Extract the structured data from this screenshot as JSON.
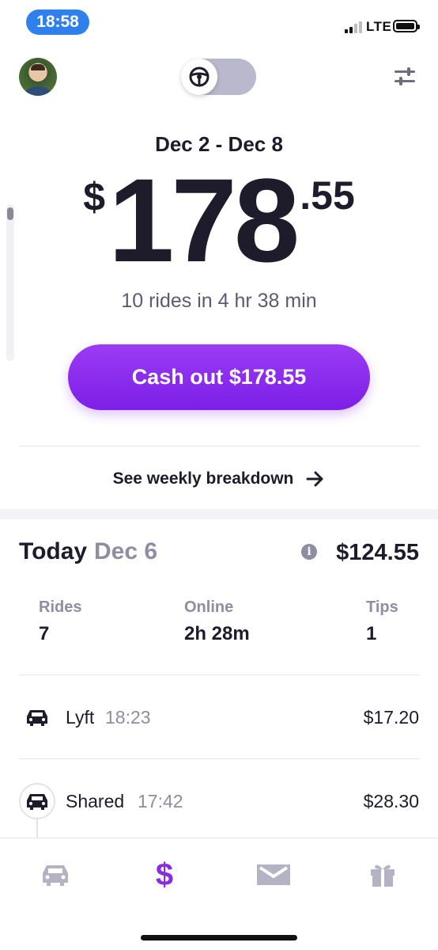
{
  "status_bar": {
    "time": "18:58",
    "network": "LTE"
  },
  "header": {
    "avatar": "profile-photo",
    "mode_toggle_icon": "steering-wheel-icon",
    "filter_icon": "sliders-icon"
  },
  "earnings": {
    "date_range": "Dec 2 - Dec 8",
    "currency_symbol": "$",
    "amount_whole": "178",
    "amount_cents": ".55",
    "rides_summary": "10 rides in 4 hr 38 min",
    "cashout_label": "Cash out $178.55",
    "weekly_breakdown_label": "See weekly breakdown"
  },
  "today": {
    "label": "Today",
    "date": "Dec 6",
    "total": "$124.55",
    "stats": [
      {
        "label": "Rides",
        "value": "7"
      },
      {
        "label": "Online",
        "value": "2h 28m"
      },
      {
        "label": "Tips",
        "value": "1"
      }
    ]
  },
  "rides": [
    {
      "type": "Lyft",
      "time": "18:23",
      "amount": "$17.20"
    },
    {
      "type": "Shared",
      "time": "17:42",
      "amount": "$28.30"
    }
  ],
  "tab_bar": {
    "tabs": [
      "car-icon",
      "dollar-icon",
      "mail-icon",
      "gift-icon"
    ],
    "active": "dollar-icon"
  },
  "colors": {
    "accent": "#8a2be2",
    "text_primary": "#1e1c2b",
    "text_secondary": "#8e8da2",
    "status_time_pill": "#2f80ed"
  }
}
